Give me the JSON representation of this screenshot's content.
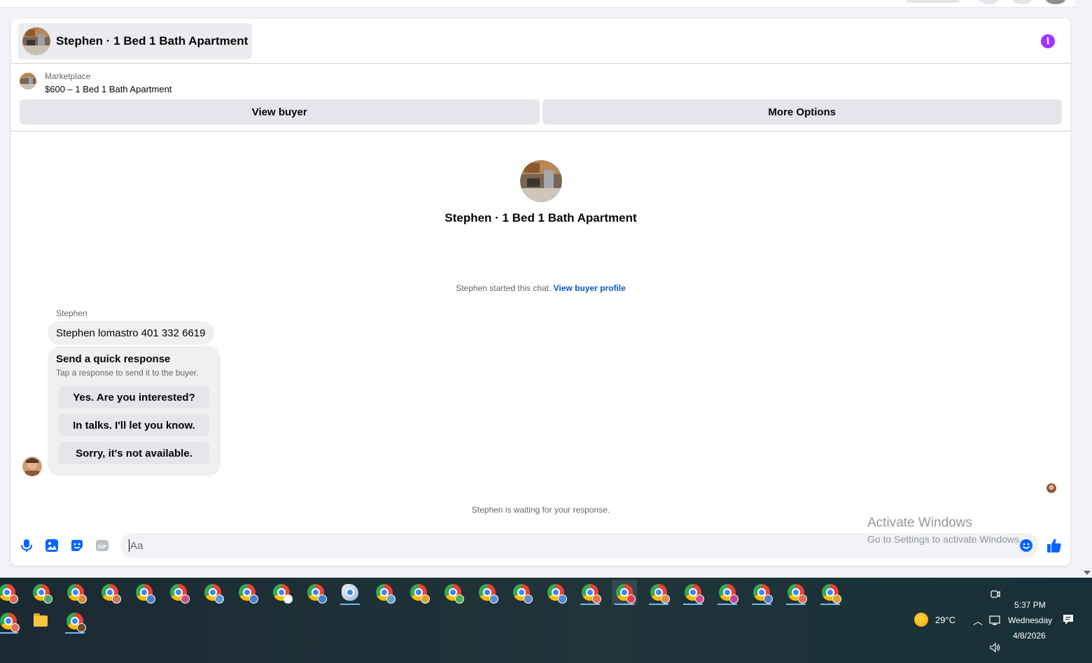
{
  "header": {
    "title": "Stephen · 1 Bed 1 Bath Apartment",
    "info_icon": "info-icon",
    "accent_color": "#a033ff"
  },
  "listing": {
    "label": "Marketplace",
    "price_title": "$600 – 1 Bed 1 Bath Apartment",
    "view_buyer_label": "View buyer",
    "more_options_label": "More Options"
  },
  "profile": {
    "name": "Stephen · 1 Bed 1 Bath Apartment"
  },
  "chat": {
    "started_text": "Stephen started this chat.",
    "view_profile_link": "View buyer profile",
    "sender": "Stephen",
    "message": "Stephen lomastro 401 332 6619",
    "quick_response": {
      "title": "Send a quick response",
      "subtitle": "Tap a response to send it to the buyer.",
      "options": [
        "Yes. Are you interested?",
        "In talks. I'll let you know.",
        "Sorry, it's not available."
      ]
    },
    "waiting_text": "Stephen is waiting for your response."
  },
  "composer": {
    "placeholder": "Aa",
    "icons": [
      "microphone-icon",
      "photo-icon",
      "sticker-icon",
      "gif-icon",
      "emoji-icon",
      "thumbs-up-icon"
    ],
    "gif_label": "GIF",
    "accent_color": "#0866ff"
  },
  "watermark": {
    "line1": "Activate Windows",
    "line2": "Go to Settings to activate Windows."
  },
  "taskbar": {
    "temperature": "29°C",
    "time": "5:37 PM",
    "day": "Wednesday",
    "date": "4/8/2026",
    "row1_profile_colors": [
      "#e06c5b",
      "#52a36b",
      "#d98b3a",
      "#c9745f",
      "#4a7fd0",
      "#d04e86",
      "#5a9bd5",
      "#4a7fd0",
      "#ffffff",
      "#3f7fcf",
      "#bc5a9e",
      "#6aa0c7",
      "#e0a030",
      "#4caf50",
      "#5b8fd8",
      "#6c86c9",
      "#4f8ad6",
      "#e07550",
      "#e04055",
      "#e08b4a",
      "#d94c8e",
      "#c33ea8",
      "#5c79c9",
      "#e36a5a",
      "#e0a040"
    ],
    "row2_profile_colors": [
      "#e06c5b",
      "#6b4b32"
    ]
  }
}
